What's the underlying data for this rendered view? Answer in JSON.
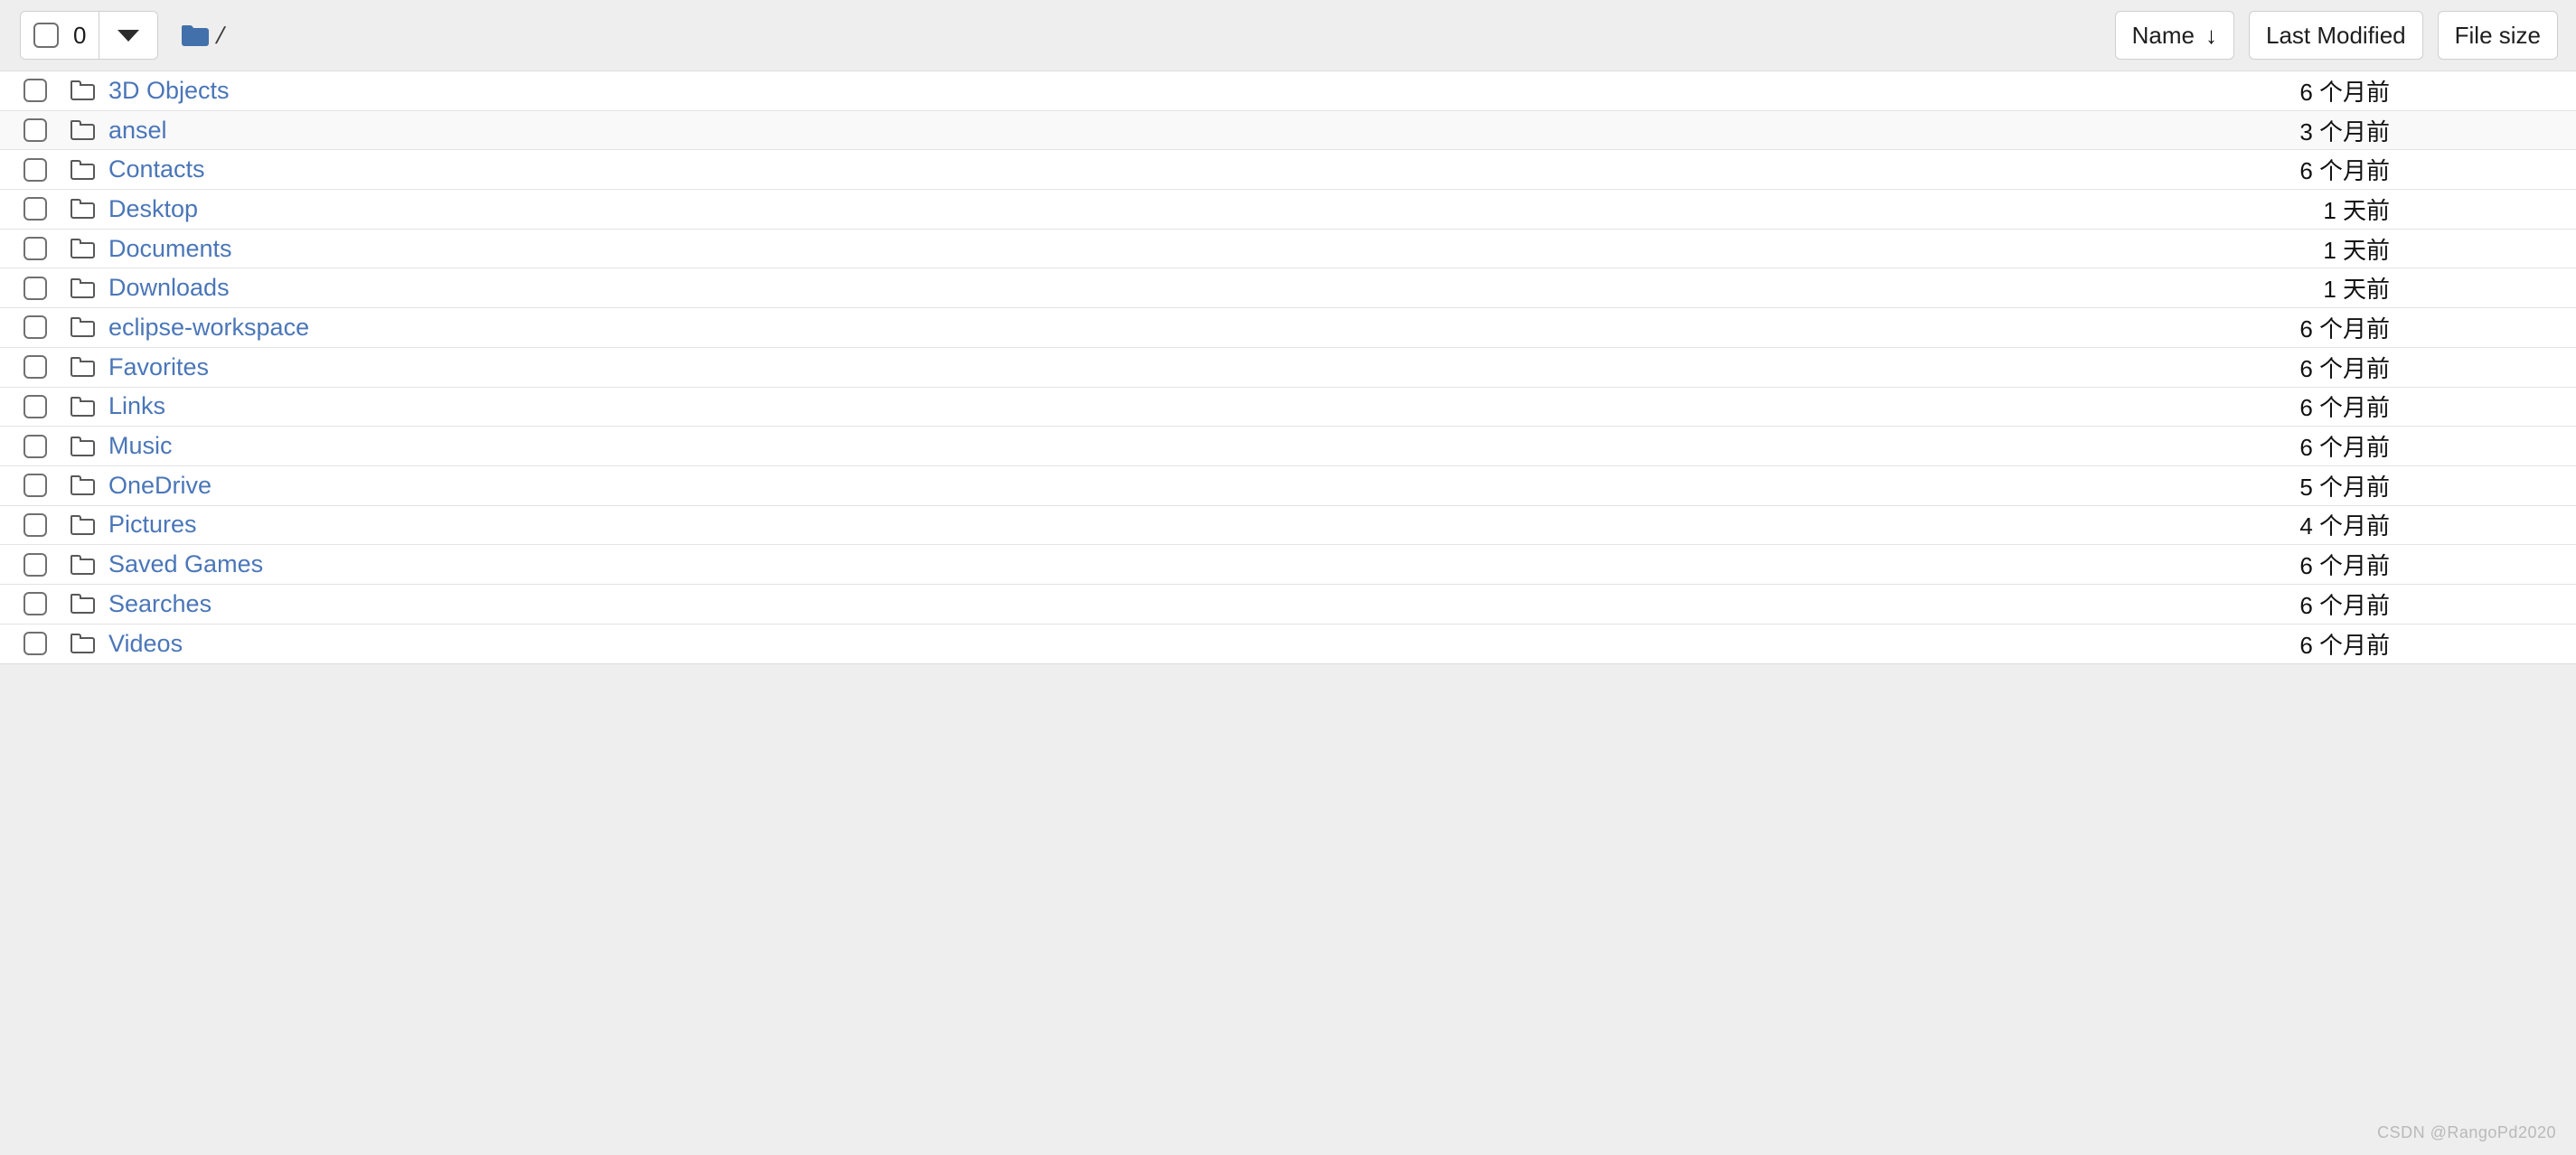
{
  "toolbar": {
    "selection_count": "0",
    "select_all_icon": "checkbox-icon",
    "dropdown_icon": "chevron-down-icon",
    "breadcrumb": {
      "folder_icon": "folder-icon",
      "path": "/"
    },
    "sort_buttons": [
      {
        "label": "Name",
        "icon": "arrow-down-icon",
        "arrow": "↓",
        "active": true
      },
      {
        "label": "Last Modified",
        "icon": "",
        "arrow": "",
        "active": false
      },
      {
        "label": "File size",
        "icon": "",
        "arrow": "",
        "active": false
      }
    ]
  },
  "table": {
    "columns": [
      "",
      "Name",
      "Last Modified",
      "File size"
    ],
    "rows": [
      {
        "name": "3D Objects",
        "icon": "folder-icon",
        "modified": "6 个月前",
        "size": "",
        "highlight": false
      },
      {
        "name": "ansel",
        "icon": "folder-icon",
        "modified": "3 个月前",
        "size": "",
        "highlight": true
      },
      {
        "name": "Contacts",
        "icon": "folder-icon",
        "modified": "6 个月前",
        "size": "",
        "highlight": false
      },
      {
        "name": "Desktop",
        "icon": "folder-icon",
        "modified": "1 天前",
        "size": "",
        "highlight": false
      },
      {
        "name": "Documents",
        "icon": "folder-icon",
        "modified": "1 天前",
        "size": "",
        "highlight": false
      },
      {
        "name": "Downloads",
        "icon": "folder-icon",
        "modified": "1 天前",
        "size": "",
        "highlight": false
      },
      {
        "name": "eclipse-workspace",
        "icon": "folder-icon",
        "modified": "6 个月前",
        "size": "",
        "highlight": false
      },
      {
        "name": "Favorites",
        "icon": "folder-icon",
        "modified": "6 个月前",
        "size": "",
        "highlight": false
      },
      {
        "name": "Links",
        "icon": "folder-icon",
        "modified": "6 个月前",
        "size": "",
        "highlight": false
      },
      {
        "name": "Music",
        "icon": "folder-icon",
        "modified": "6 个月前",
        "size": "",
        "highlight": false
      },
      {
        "name": "OneDrive",
        "icon": "folder-icon",
        "modified": "5 个月前",
        "size": "",
        "highlight": false
      },
      {
        "name": "Pictures",
        "icon": "folder-icon",
        "modified": "4 个月前",
        "size": "",
        "highlight": false
      },
      {
        "name": "Saved Games",
        "icon": "folder-icon",
        "modified": "6 个月前",
        "size": "",
        "highlight": false
      },
      {
        "name": "Searches",
        "icon": "folder-icon",
        "modified": "6 个月前",
        "size": "",
        "highlight": false
      },
      {
        "name": "Videos",
        "icon": "folder-icon",
        "modified": "6 个月前",
        "size": "",
        "highlight": false
      }
    ]
  },
  "watermark": "CSDN @RangoPd2020",
  "colors": {
    "link": "#4a76b8",
    "folder_solid": "#4270aa",
    "page_bg": "#eeeeee",
    "row_bg": "#ffffff",
    "row_highlight": "#f9f9f9",
    "border": "#e3e3e3"
  }
}
